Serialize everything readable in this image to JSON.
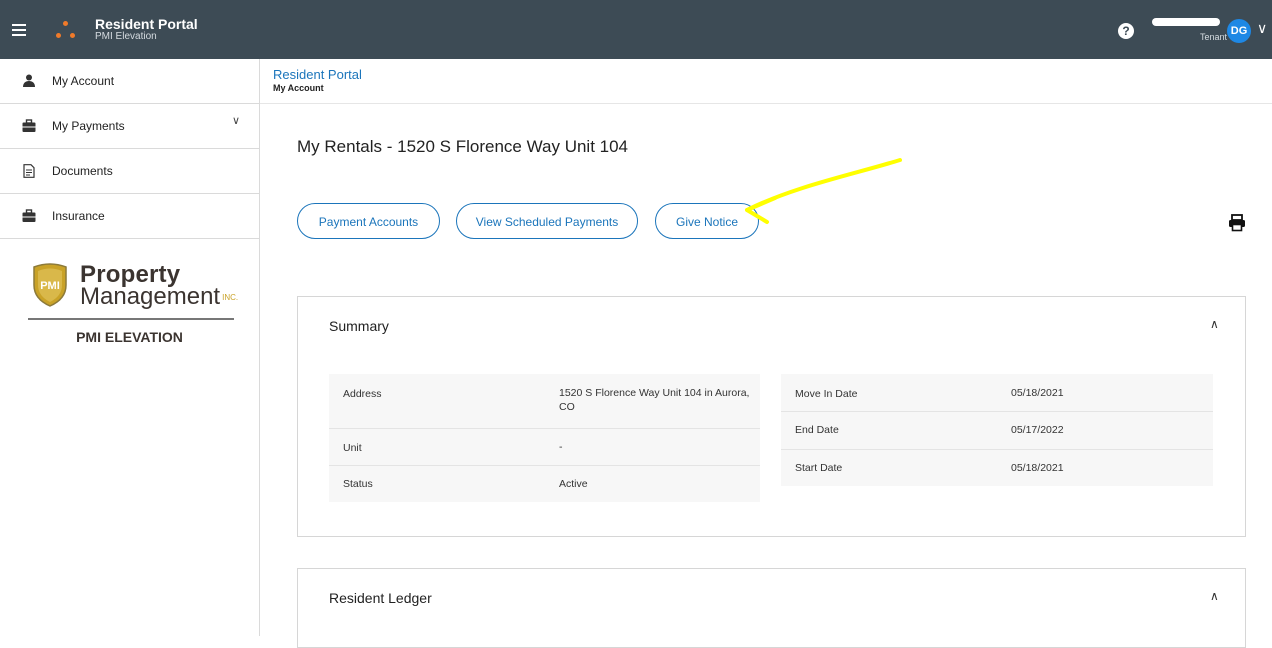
{
  "topbar": {
    "app_title": "Resident Portal",
    "app_subtitle": "PMI Elevation",
    "user_role": "Tenant",
    "user_initials": "DG",
    "help_glyph": "?",
    "colors": {
      "bar": "#3d4b55",
      "accent": "#1b75bb",
      "avatar": "#1e88e5",
      "logo": "#f07a2a"
    }
  },
  "sidebar": {
    "items": [
      {
        "label": "My Account",
        "icon": "user-icon"
      },
      {
        "label": "My Payments",
        "icon": "briefcase-icon",
        "expandable": true
      },
      {
        "label": "Documents",
        "icon": "document-icon"
      },
      {
        "label": "Insurance",
        "icon": "briefcase-icon"
      }
    ],
    "brand": {
      "line1": "Property",
      "line2": "Management",
      "shield_text": "PMI",
      "inc": "INC.",
      "company": "PMI ELEVATION"
    }
  },
  "breadcrumb": {
    "link": "Resident Portal",
    "current": "My Account"
  },
  "main": {
    "title": "My Rentals - 1520 S Florence Way Unit 104",
    "buttons": [
      {
        "label": "Payment Accounts"
      },
      {
        "label": "View Scheduled Payments"
      },
      {
        "label": "Give Notice"
      }
    ],
    "annotation_color": "#ffff00",
    "summary": {
      "title": "Summary",
      "left": [
        {
          "label": "Address",
          "value": "1520 S Florence Way Unit 104 in Aurora, CO"
        },
        {
          "label": "Unit",
          "value": "-"
        },
        {
          "label": "Status",
          "value": "Active"
        }
      ],
      "right": [
        {
          "label": "Move In Date",
          "value": "05/18/2021"
        },
        {
          "label": "End Date",
          "value": "05/17/2022"
        },
        {
          "label": "Start Date",
          "value": "05/18/2021"
        }
      ]
    },
    "ledger": {
      "title": "Resident Ledger"
    }
  }
}
